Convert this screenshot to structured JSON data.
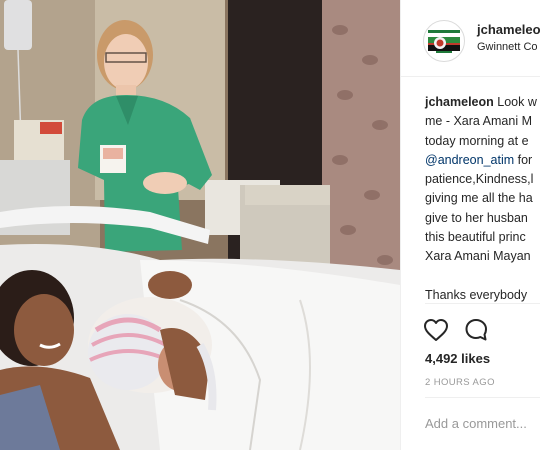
{
  "post": {
    "photo_alt": "Hospital room: nurse in green scrubs standing behind a smiling mother holding a newborn baby in a pink and white knit hat",
    "colors": {
      "accent": "#003569",
      "muted": "#999999",
      "border": "#efefef"
    }
  },
  "header": {
    "username": "jchameleon",
    "location": "Gwinnett Co",
    "avatar_icon": "flag-logo-icon"
  },
  "caption": {
    "lines": [
      {
        "user": "jchameleon",
        "text": " Look w"
      },
      {
        "text": "me - Xara Amani M"
      },
      {
        "text": "today morning at e"
      },
      {
        "mention": "@andreon_atim",
        "text": " for"
      },
      {
        "text": "patience,Kindness,l"
      },
      {
        "text": "giving me all the ha"
      },
      {
        "text": "give to her husban"
      },
      {
        "text": "this beautiful princ"
      },
      {
        "text": "Xara Amani Mayan"
      },
      {
        "text": ""
      },
      {
        "text": "Thanks everybody"
      }
    ]
  },
  "actions": {
    "like_icon": "heart-icon",
    "comment_icon": "comment-bubble-icon"
  },
  "likes": {
    "count": "4,492 likes"
  },
  "timestamp": "2 HOURS AGO",
  "comment_box": {
    "placeholder": "Add a comment..."
  }
}
